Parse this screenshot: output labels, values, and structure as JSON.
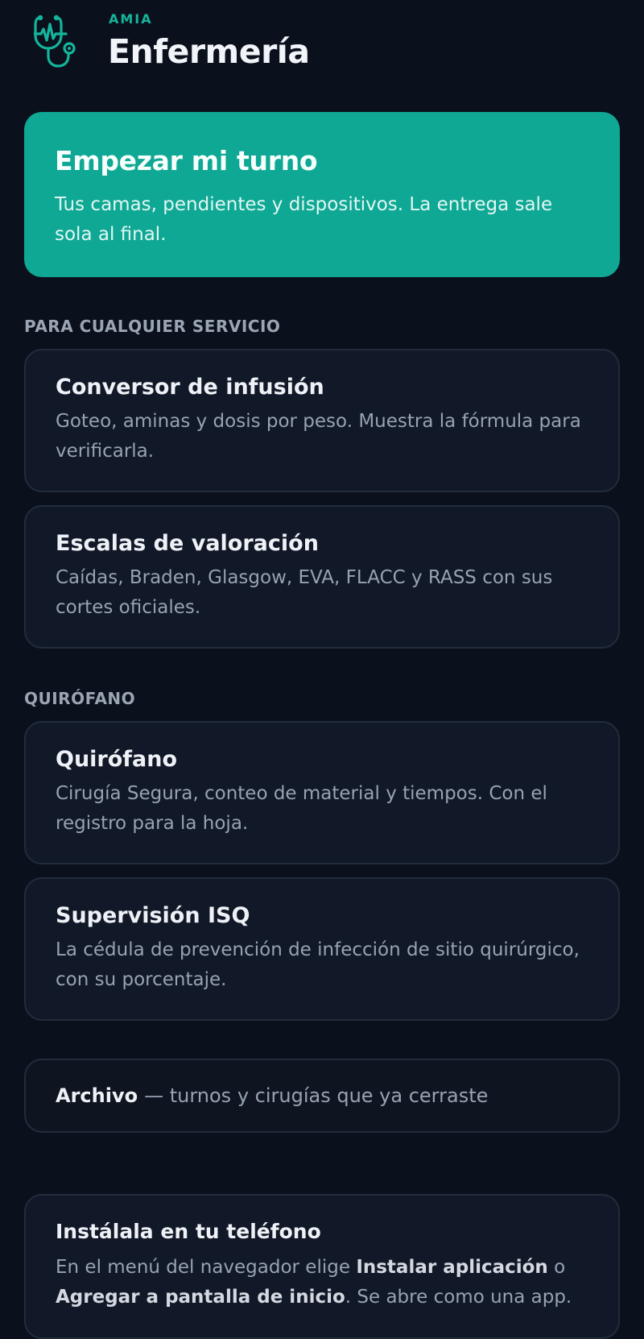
{
  "header": {
    "brand": "AMIA",
    "title": "Enfermería",
    "logo_icon": "stethoscope-heartbeat-icon"
  },
  "hero": {
    "title": "Empezar mi turno",
    "subtitle": "Tus camas, pendientes y dispositivos. La entrega sale sola al final."
  },
  "sections": {
    "general_label": "PARA CUALQUIER SERVICIO",
    "or_label": "QUIRÓFANO"
  },
  "cards": {
    "infusion": {
      "title": "Conversor de infusión",
      "desc": "Goteo, aminas y dosis por peso. Muestra la fórmula para verificarla."
    },
    "scales": {
      "title": "Escalas de valoración",
      "desc": "Caídas, Braden, Glasgow, EVA, FLACC y RASS con sus cortes oficiales."
    },
    "or": {
      "title": "Quirófano",
      "desc": "Cirugía Segura, conteo de material y tiempos. Con el registro para la hoja."
    },
    "isq": {
      "title": "Supervisión ISQ",
      "desc": "La cédula de prevención de infección de sitio quirúrgico, con su porcentaje."
    }
  },
  "archive": {
    "title": "Archivo",
    "desc": "— turnos y cirugías que ya cerraste"
  },
  "install": {
    "title": "Instálala en tu teléfono",
    "text_before": "En el menú del navegador elige ",
    "text_bold_1": "Instalar aplicación",
    "text_middle": " o ",
    "text_bold_2": "Agregar a pantalla de inicio",
    "text_after": ". Se abre como una app."
  },
  "colors": {
    "background": "#0b111c",
    "accent": "#0ea894",
    "brand": "#14b59c",
    "card": "#111827",
    "card_border": "#222c3c"
  }
}
